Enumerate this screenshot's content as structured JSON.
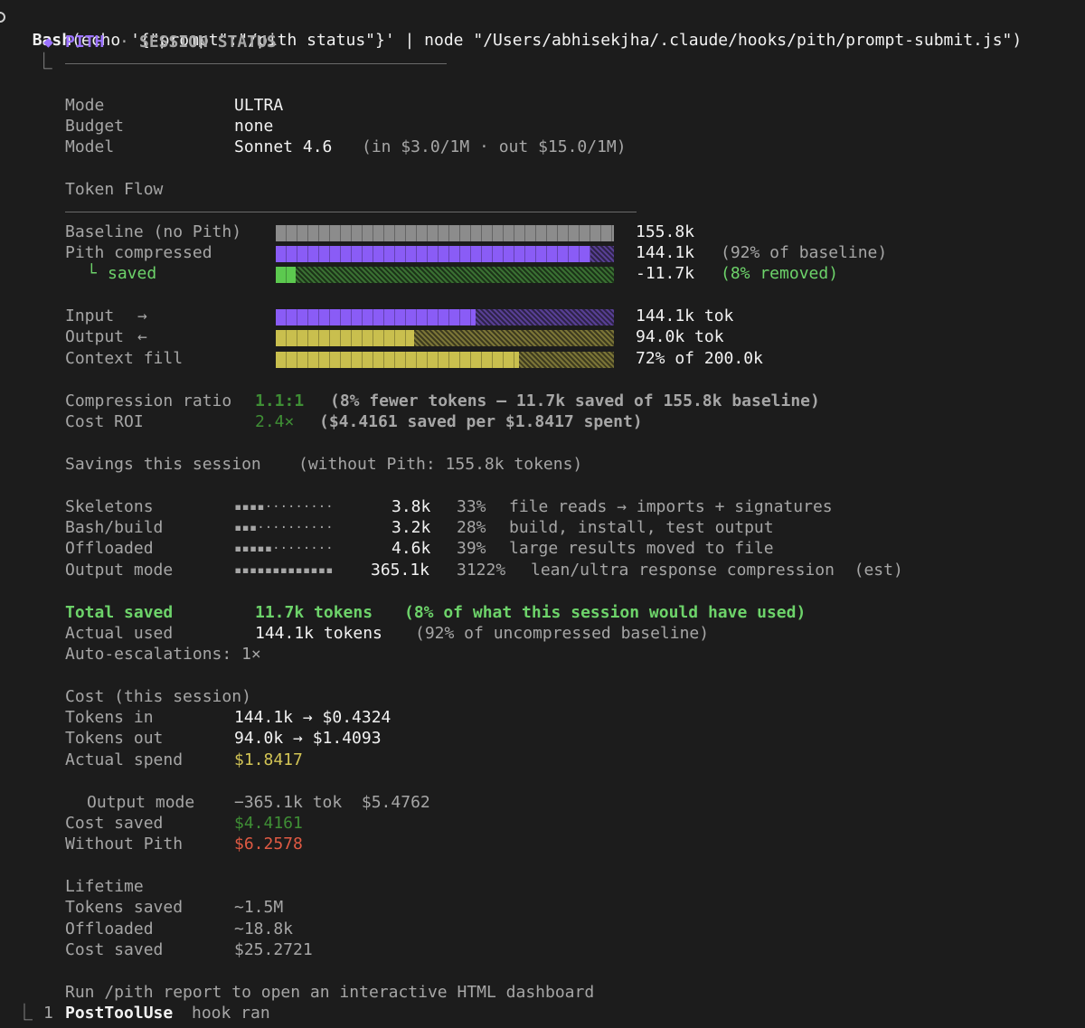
{
  "header": {
    "command_name": "Bash",
    "command_args": "(echo '{\"prompt\":\"/pith status\"}' | node \"/Users/abhisekjha/.claude/hooks/pith/prompt-submit.js\")",
    "tree_glyph": "⎿",
    "diamond": "◆",
    "brand": "PITH",
    "separator": "·",
    "title": "SESSION STATUS"
  },
  "info": {
    "mode_label": "Mode",
    "mode_value": "ULTRA",
    "budget_label": "Budget",
    "budget_value": "none",
    "model_label": "Model",
    "model_value": "Sonnet 4.6",
    "model_pricing": "(in $3.0/1M · out $15.0/1M)"
  },
  "token_flow": {
    "heading": "Token Flow",
    "baseline": {
      "label": "Baseline (no Pith)",
      "value": "155.8k",
      "fill": 1.0,
      "color": "#8c8c8c"
    },
    "compressed": {
      "label": "Pith compressed",
      "value": "144.1k",
      "note": "(92% of baseline)",
      "fill": 0.93,
      "color": "#8a5cf6"
    },
    "saved": {
      "glyph": "└",
      "label": "saved",
      "value": "-11.7k",
      "note": "(8% removed)",
      "fill": 0.06,
      "color": "#5cc94f",
      "rest_color": "#3e7a36"
    },
    "input": {
      "label": "Input",
      "arrow": "→",
      "value": "144.1k tok",
      "fill": 0.59,
      "color": "#8a5cf6"
    },
    "output": {
      "label": "Output",
      "arrow": "←",
      "value": "94.0k tok",
      "fill": 0.41,
      "color": "#c9bf4e"
    },
    "context": {
      "label": "Context fill",
      "value": "72% of 200.0k",
      "fill": 0.72,
      "color": "#c9bf4e"
    }
  },
  "ratios": {
    "compression_label": "Compression ratio",
    "compression_value": "1.1:1",
    "compression_note": "(8% fewer tokens — 11.7k saved of 155.8k baseline)",
    "roi_label": "Cost ROI",
    "roi_value": "2.4×",
    "roi_note": "($4.4161 saved per $1.8417 spent)"
  },
  "savings": {
    "heading": "Savings this session",
    "heading_note": "(without Pith: 155.8k tokens)",
    "rows": [
      {
        "label": "Skeletons",
        "bar": "▪▪▪▪·········",
        "value": "3.8k",
        "pct": "33%",
        "desc": "file reads → imports + signatures"
      },
      {
        "label": "Bash/build",
        "bar": "▪▪▪··········",
        "value": "3.2k",
        "pct": "28%",
        "desc": "build, install, test output"
      },
      {
        "label": "Offloaded",
        "bar": "▪▪▪▪▪········",
        "value": "4.6k",
        "pct": "39%",
        "desc": "large results moved to file"
      },
      {
        "label": "Output mode",
        "bar": "▪▪▪▪▪▪▪▪▪▪▪▪▪",
        "value": "365.1k",
        "pct": "3122%",
        "desc": "lean/ultra response compression  (est)"
      }
    ]
  },
  "totals": {
    "total_label": "Total saved",
    "total_value": "11.7k tokens",
    "total_note": "(8% of what this session would have used)",
    "actual_label": "Actual used",
    "actual_value": "144.1k tokens",
    "actual_note": "(92% of uncompressed baseline)",
    "escalations": "Auto-escalations: 1×"
  },
  "cost": {
    "heading": "Cost (this session)",
    "tokens_in_label": "Tokens in",
    "tokens_in_value": "144.1k → $0.4324",
    "tokens_out_label": "Tokens out",
    "tokens_out_value": "94.0k → $1.4093",
    "spend_label": "Actual spend",
    "spend_value": "$1.8417",
    "output_mode_label": "Output mode",
    "output_mode_value": "−365.1k tok  $5.4762",
    "saved_label": "Cost saved",
    "saved_value": "$4.4161",
    "without_label": "Without Pith",
    "without_value": "$6.2578"
  },
  "lifetime": {
    "heading": "Lifetime",
    "tokens_label": "Tokens saved",
    "tokens_value": "~1.5M",
    "offloaded_label": "Offloaded",
    "offloaded_value": "~18.8k",
    "cost_label": "Cost saved",
    "cost_value": "$25.2721"
  },
  "footer": {
    "report_hint": "Run /pith report to open an interactive HTML dashboard",
    "hook_glyph": "⎿",
    "hook_count": "1",
    "hook_name": "PostToolUse",
    "hook_suffix": "hook ran"
  }
}
